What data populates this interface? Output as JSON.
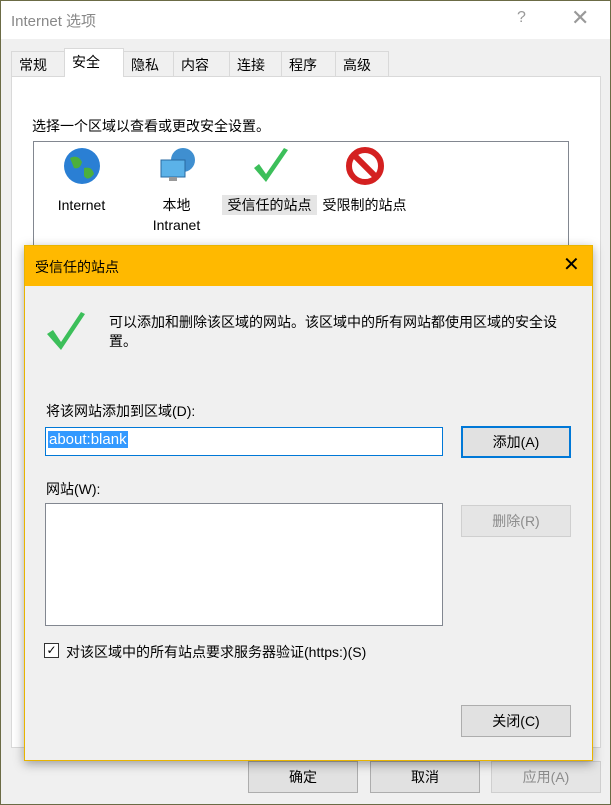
{
  "window": {
    "title": "Internet 选项",
    "help": "?",
    "close": "✕"
  },
  "tabs": [
    {
      "label": "常规"
    },
    {
      "label": "安全"
    },
    {
      "label": "隐私"
    },
    {
      "label": "内容"
    },
    {
      "label": "连接"
    },
    {
      "label": "程序"
    },
    {
      "label": "高级"
    }
  ],
  "selected_tab": "安全",
  "security": {
    "prompt": "选择一个区域以查看或更改安全设置。",
    "zones": [
      {
        "label": "Internet",
        "icon": "globe-icon"
      },
      {
        "label": "本地\nIntranet",
        "icon": "intranet-icon"
      },
      {
        "label": "受信任的站点",
        "icon": "checkmark-icon"
      },
      {
        "label": "受限制的站点",
        "icon": "no-entry-icon"
      }
    ]
  },
  "dialog": {
    "title": "受信任的站点",
    "close": "✕",
    "description": "可以添加和删除该区域的网站。该区域中的所有网站都使用区域的安全设置。",
    "add_label": "将该网站添加到区域(D):",
    "add_value": "about:blank",
    "add_button": "添加(A)",
    "sites_label": "网站(W):",
    "sites": [],
    "remove_button": "删除(R)",
    "https_checkbox": {
      "label": "对该区域中的所有站点要求服务器验证(https:)(S)",
      "checked": true
    },
    "close_button": "关闭(C)",
    "title_color": "#ffb900"
  },
  "footer": {
    "ok": "确定",
    "cancel": "取消",
    "apply": "应用(A)"
  }
}
